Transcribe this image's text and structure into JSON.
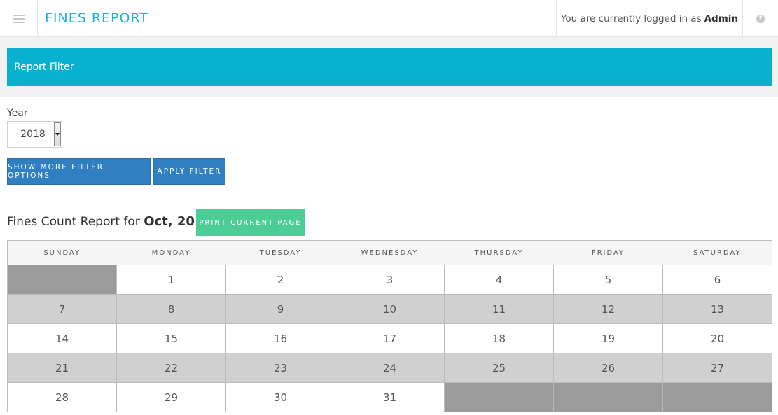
{
  "header": {
    "title": "FINES REPORT",
    "login_prefix": "You are currently logged in as",
    "login_user": "Admin"
  },
  "filter": {
    "panel_title": "Report Filter",
    "year_label": "Year",
    "year_value": "2018",
    "more_options_label": "SHOW MORE FILTER OPTIONS",
    "apply_label": "APPLY FILTER"
  },
  "report": {
    "title_prefix": "Fines Count Report for",
    "period": "Oct, 2018",
    "print_label": "PRINT CURRENT PAGE"
  },
  "calendar": {
    "weekdays": [
      "SUNDAY",
      "MONDAY",
      "TUESDAY",
      "WEDNESDAY",
      "THURSDAY",
      "FRIDAY",
      "SATURDAY"
    ],
    "weeks": [
      [
        "",
        "1",
        "2",
        "3",
        "4",
        "5",
        "6"
      ],
      [
        "7",
        "8",
        "9",
        "10",
        "11",
        "12",
        "13"
      ],
      [
        "14",
        "15",
        "16",
        "17",
        "18",
        "19",
        "20"
      ],
      [
        "21",
        "22",
        "23",
        "24",
        "25",
        "26",
        "27"
      ],
      [
        "28",
        "29",
        "30",
        "31",
        "",
        "",
        ""
      ]
    ]
  },
  "colors": {
    "brand": "#21b1d6",
    "filter_panel": "#08b2cf",
    "primary_button": "#2f7fc1",
    "print_button": "#4dcd96"
  },
  "icons": {
    "menu": "menu-icon",
    "help": "help-icon"
  }
}
